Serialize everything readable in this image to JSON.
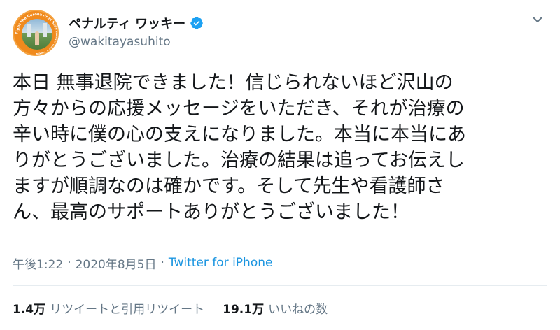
{
  "tweet": {
    "author": {
      "display_name": "ペナルティ ワッキー",
      "handle": "@wakitayasuhito",
      "verified": true,
      "avatar_ring_text": "Fight the Coronavirus Stay home Save lives"
    },
    "text": "本日 無事退院できました！信じられないほど沢山の\n方々からの応援メッセージをいただき、それが治療の\n辛い時に僕の心の支えになりました。本当に本当にあ\nりがとうございました。治療の結果は追ってお伝えし\nますが順調なのは確かです。そして先生や看護師さ\nん、最高のサポートありがとうございました！",
    "time": "午後1:22",
    "date": "2020年8月5日",
    "separator": "·",
    "source": "Twitter for iPhone",
    "stats": {
      "retweets_count": "1.4万",
      "retweets_label": "リツイートと引用リツイート",
      "likes_count": "19.1万",
      "likes_label": "いいねの数"
    }
  },
  "colors": {
    "text": "#14171a",
    "secondary": "#657786",
    "link": "#1b95e0",
    "verified": "#1da1f2",
    "avatar_ring": "#f08a1d",
    "divider": "#e6ecf0"
  },
  "icons": {
    "verified": "verified-badge-icon",
    "more": "chevron-down-icon"
  }
}
